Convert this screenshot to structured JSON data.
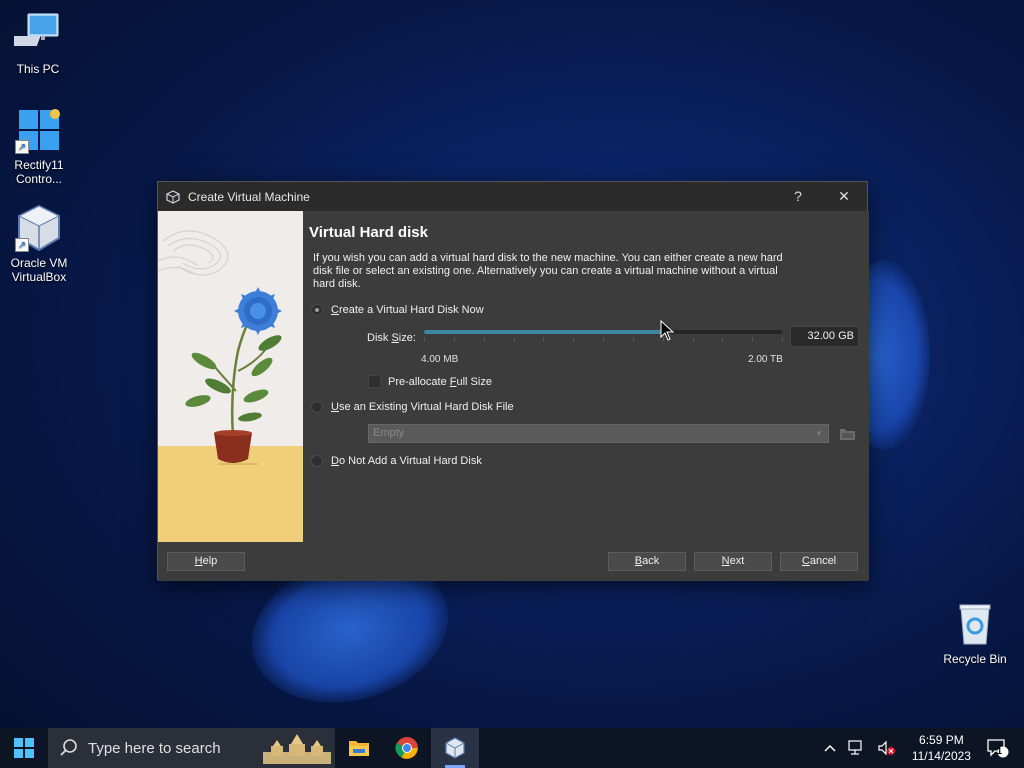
{
  "desktop": {
    "icons": [
      {
        "label": "This PC"
      },
      {
        "label": "Rectify11 Contro..."
      },
      {
        "label": "Oracle VM VirtualBox"
      },
      {
        "label": "Recycle Bin"
      }
    ]
  },
  "dialog": {
    "title": "Create Virtual Machine",
    "help_glyph": "?",
    "close_glyph": "✕",
    "heading": "Virtual Hard disk",
    "description": "If you wish you can add a virtual hard disk to the new machine. You can either create a new hard disk file or select an existing one. Alternatively you can create a virtual machine without a virtual hard disk.",
    "options": {
      "create_now": {
        "label": "Create a Virtual Hard Disk Now",
        "selected": true
      },
      "use_existing": {
        "label": "Use an Existing Virtual Hard Disk File",
        "selected": false
      },
      "no_disk": {
        "label": "Do Not Add a Virtual Hard Disk",
        "selected": false
      }
    },
    "disk_size": {
      "label": "Disk Size:",
      "value": "32.00 GB",
      "min_label": "4.00 MB",
      "max_label": "2.00 TB",
      "slider_fraction": 0.67
    },
    "preallocate": {
      "label": "Pre-allocate Full Size",
      "checked": false
    },
    "existing_combo": {
      "value": "Empty"
    },
    "buttons": {
      "help": "Help",
      "back": "Back",
      "next": "Next",
      "cancel": "Cancel"
    }
  },
  "taskbar": {
    "search_placeholder": "Type here to search",
    "time": "6:59 PM",
    "date": "11/14/2023",
    "notification_count": "1"
  },
  "colors": {
    "dialog_bg": "#3c3c3c",
    "titlebar_bg": "#2b2b2b",
    "slider_fill": "#3f86a3",
    "taskbar_bg": "#0d1524"
  }
}
